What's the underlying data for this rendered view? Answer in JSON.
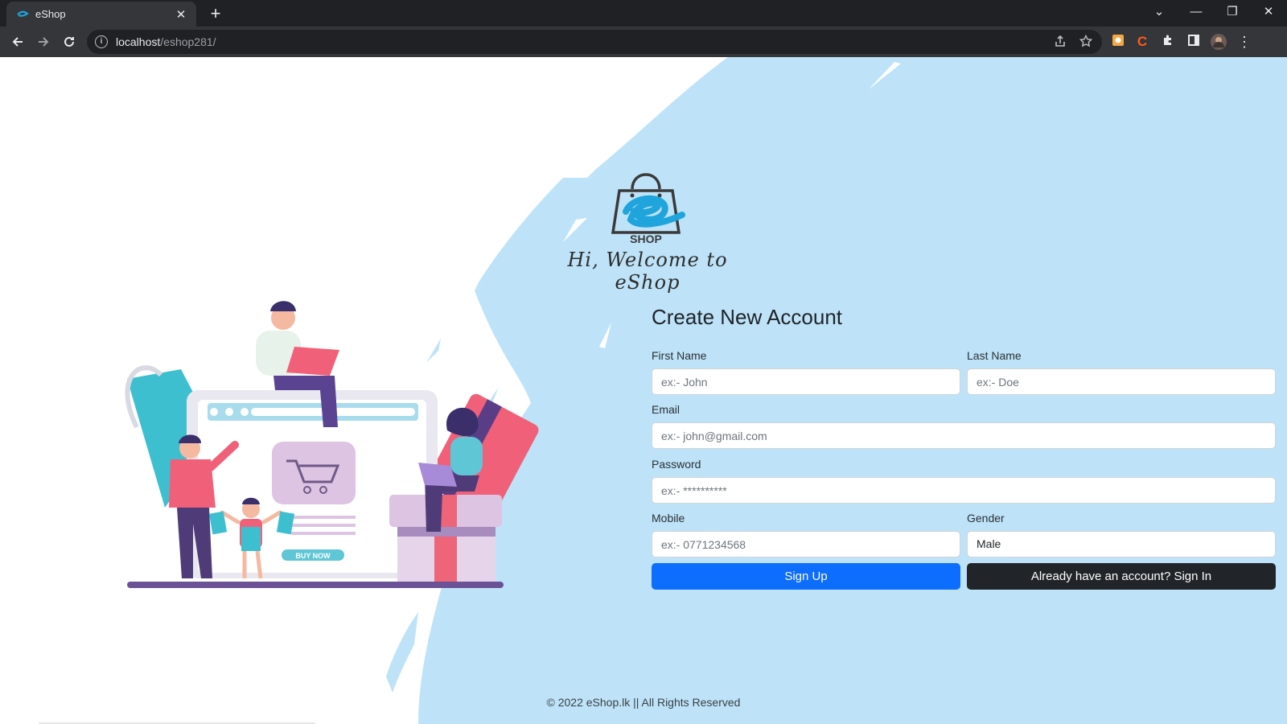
{
  "browser": {
    "tab_title": "eShop",
    "tab_close": "✕",
    "new_tab": "+",
    "url_host": "localhost",
    "url_path": "/eshop281/",
    "window_controls": [
      "⌄",
      "—",
      "❐",
      "✕"
    ]
  },
  "page": {
    "logo_text": "SHOP",
    "welcome": "Hi, Welcome to eShop",
    "illustration_button": "BUY NOW",
    "form": {
      "title": "Create New Account",
      "first_name": {
        "label": "First Name",
        "placeholder": "ex:- John"
      },
      "last_name": {
        "label": "Last Name",
        "placeholder": "ex:- Doe"
      },
      "email": {
        "label": "Email",
        "placeholder": "ex:- john@gmail.com"
      },
      "password": {
        "label": "Password",
        "placeholder": "ex:- **********"
      },
      "mobile": {
        "label": "Mobile",
        "placeholder": "ex:- 0771234568"
      },
      "gender": {
        "label": "Gender",
        "value": "Male"
      },
      "signup_label": "Sign Up",
      "signin_label": "Already have an account? Sign In"
    },
    "footer": "© 2022 eShop.lk || All Rights Reserved"
  },
  "colors": {
    "background_blue": "#bee3f8",
    "primary": "#0d6efd",
    "dark": "#212529",
    "logo_blue": "#1fa4dc"
  },
  "icons": [
    "back-icon",
    "forward-icon",
    "reload-icon",
    "info-icon",
    "share-icon",
    "star-icon",
    "extension-icon",
    "sidebar-icon",
    "profile-icon",
    "menu-icon"
  ]
}
